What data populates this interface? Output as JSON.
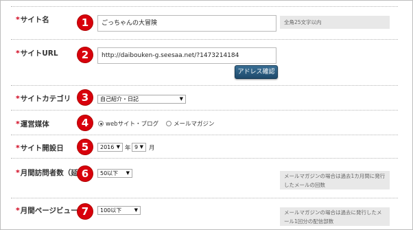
{
  "form": {
    "rows": [
      {
        "label": "サイト名",
        "badge": "1"
      },
      {
        "label": "サイトURL",
        "badge": "2"
      },
      {
        "label": "サイトカテゴリ",
        "badge": "3"
      },
      {
        "label": "運営媒体",
        "badge": "4"
      },
      {
        "label": "サイト開設日",
        "badge": "5"
      },
      {
        "label": "月間訪問者数（延べ",
        "badge": "6"
      },
      {
        "label": "月間ページビュー数",
        "badge": "7"
      }
    ],
    "required_mark": "*",
    "site_name": {
      "value": "ごっちゃんの大冒険",
      "hint": "全角25文字以内"
    },
    "site_url": {
      "value": "http://daibouken-g.seesaa.net/?1473214184",
      "confirm_button": "アドレス確認"
    },
    "category": {
      "selected": "自己紹介・日記"
    },
    "media": {
      "option1": "webサイト・ブログ",
      "option2": "メールマガジン",
      "selected": "webサイト・ブログ"
    },
    "open_date": {
      "year": "2016",
      "year_unit": "年",
      "month": "9",
      "month_unit": "月"
    },
    "visitors": {
      "selected": "50以下",
      "hint": "メールマガジンの場合は過去1カ月間に発行したメールの回数"
    },
    "pageviews": {
      "selected": "100以下",
      "hint": "メールマガジンの場合は過去に発行したメール1回分の配信部数"
    }
  }
}
